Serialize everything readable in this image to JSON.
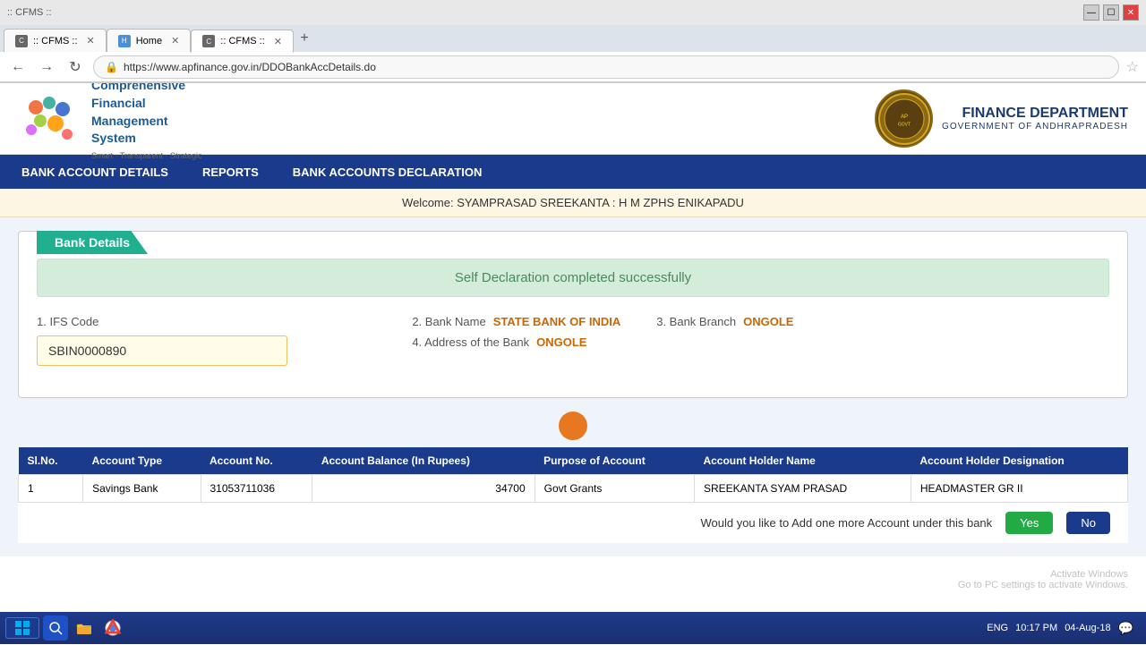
{
  "browser": {
    "tabs": [
      {
        "label": ":: CFMS ::",
        "active": false,
        "favicon": "C"
      },
      {
        "label": "Home",
        "active": false,
        "favicon": "H"
      },
      {
        "label": ":: CFMS ::",
        "active": true,
        "favicon": "C"
      }
    ],
    "url": "https://www.apfinance.gov.in/DDOBankAccDetails.do",
    "secure_label": "Secure"
  },
  "header": {
    "logo_text": "Comprehensive\nFinancial\nManagement\nSystem",
    "logo_tagline": "Smart · Transparent · Strategic",
    "dept_name": "FINANCE DEPARTMENT",
    "dept_sub": "GOVERNMENT OF ANDHRAPRADESH"
  },
  "nav": {
    "items": [
      "BANK ACCOUNT DETAILS",
      "REPORTS",
      "BANK ACCOUNTS DECLARATION"
    ]
  },
  "welcome": {
    "text": "Welcome: SYAMPRASAD SREEKANTA : H M ZPHS ENIKAPADU"
  },
  "bank_card": {
    "label": "Bank Details",
    "success_message": "Self Declaration completed successfully",
    "ifs_code_label": "1. IFS Code",
    "ifs_code_value": "SBIN0000890",
    "bank_name_label": "2. Bank Name",
    "bank_name_value": "STATE BANK OF INDIA",
    "bank_branch_label": "3. Bank Branch",
    "bank_branch_value": "ONGOLE",
    "address_label": "4. Address of the Bank",
    "address_value": "ONGOLE"
  },
  "table": {
    "headers": [
      "Sl.No.",
      "Account Type",
      "Account No.",
      "Account Balance (In Rupees)",
      "Purpose of Account",
      "Account Holder Name",
      "Account Holder Designation"
    ],
    "rows": [
      {
        "sl_no": "1",
        "account_type": "Savings Bank",
        "account_no": "31053711036",
        "balance": "34700",
        "purpose": "Govt Grants",
        "holder_name": "SREEKANTA SYAM PRASAD",
        "holder_designation": "HEADMASTER GR II"
      }
    ]
  },
  "question": {
    "text": "Would you like to Add one more Account under this bank",
    "yes_label": "Yes",
    "no_label": "No"
  },
  "taskbar": {
    "time": "10:17 PM",
    "date": "04-Aug-18",
    "lang": "ENG"
  },
  "activate": {
    "line1": "Activate Windows",
    "line2": "Go to PC settings to activate Windows."
  }
}
